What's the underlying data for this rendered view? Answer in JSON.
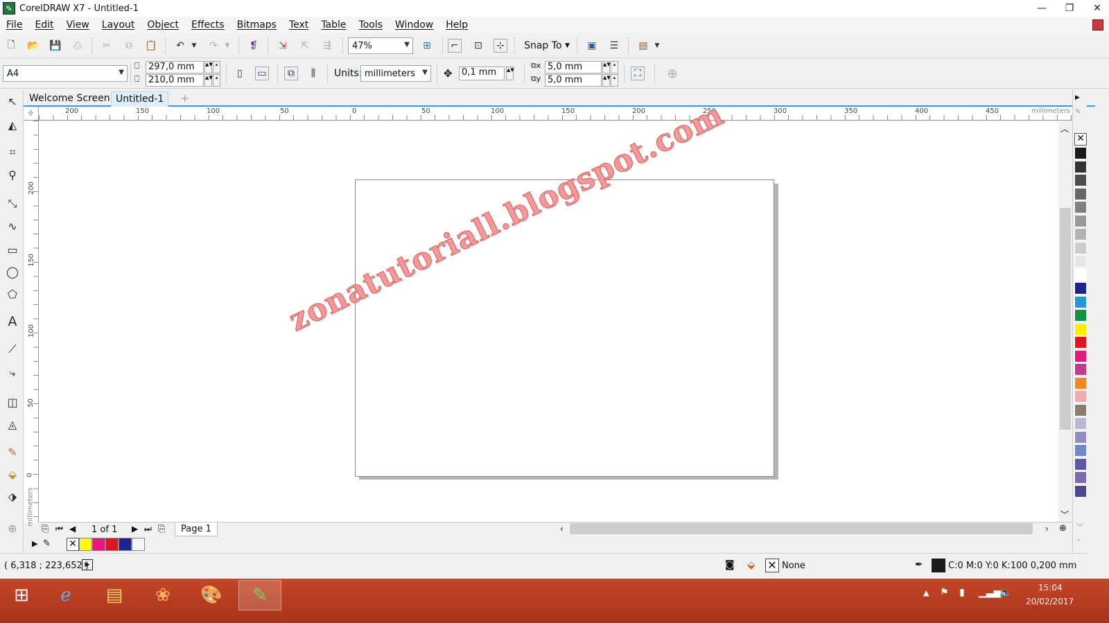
{
  "window": {
    "title": "CorelDRAW X7 - Untitled-1",
    "app_logo": "coreldraw-logo"
  },
  "menu": [
    "File",
    "Edit",
    "View",
    "Layout",
    "Object",
    "Effects",
    "Bitmaps",
    "Text",
    "Table",
    "Tools",
    "Window",
    "Help"
  ],
  "toolbar": {
    "zoom": "47%",
    "snap_label": "Snap To"
  },
  "propbar": {
    "page_size": "A4",
    "width": "297,0 mm",
    "height": "210,0 mm",
    "units_label": "Units:",
    "units_value": "millimeters",
    "nudge": "0,1 mm",
    "dup_x": "5,0 mm",
    "dup_y": "5,0 mm"
  },
  "tabs": [
    {
      "label": "Welcome Screen",
      "active": false
    },
    {
      "label": "Untitled-1",
      "active": true
    }
  ],
  "ruler": {
    "h_ticks": [
      "200",
      "150",
      "100",
      "50",
      "0",
      "50",
      "100",
      "150",
      "200",
      "250",
      "300",
      "350",
      "400",
      "450"
    ],
    "h_unit": "millimeters",
    "v_ticks": [
      "200",
      "150",
      "100",
      "50",
      "0"
    ],
    "v_unit": "millimeters"
  },
  "watermark": "zonatutoriall.blogspot.com",
  "pagenav": {
    "counter": "1 of 1",
    "page_tab": "Page 1"
  },
  "doc_palette_colors": [
    "#ffff00",
    "#e8177d",
    "#e0161f",
    "#1c2490",
    "#f4f4f4"
  ],
  "palette_colors": [
    "#1a1a1a",
    "#333333",
    "#4d4d4d",
    "#666666",
    "#808080",
    "#999999",
    "#b3b3b3",
    "#cccccc",
    "#e6e6e6",
    "#ffffff",
    "#1c2490",
    "#1f9ad6",
    "#0a9444",
    "#ffee00",
    "#e0161f",
    "#e8177d",
    "#c23a8e",
    "#f08a1c",
    "#f2a9b0",
    "#8c7b6e",
    "#b8b8d8",
    "#8e8ec6",
    "#6e88c8",
    "#5a5aa8",
    "#7a6ab0",
    "#4a4a8a"
  ],
  "status": {
    "coords": "( 6,318 ; 223,652 )",
    "fill": "None",
    "outline": "C:0 M:0 Y:0 K:100  0,200 mm"
  },
  "taskbar": {
    "time": "15:04",
    "date": "20/02/2017"
  }
}
